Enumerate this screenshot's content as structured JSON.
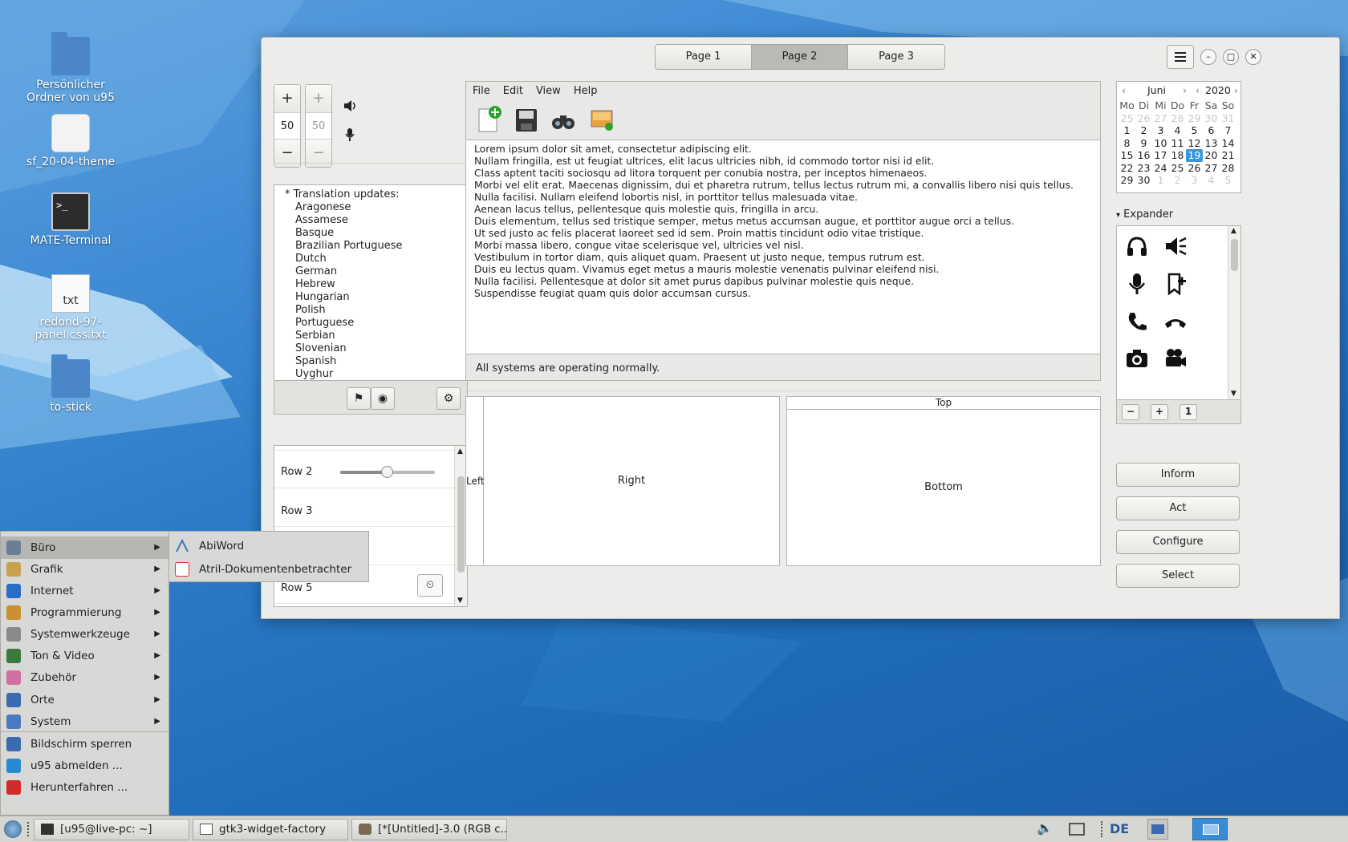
{
  "desktop": {
    "icons": [
      {
        "label": "Persönlicher Ordner von u95",
        "icon": "home-folder-icon"
      },
      {
        "label": "sf_20-04-theme",
        "icon": "drive-icon"
      },
      {
        "label": "MATE-Terminal",
        "icon": "terminal-icon"
      },
      {
        "label": "redond-97-panel.css.txt",
        "icon": "text-file-icon"
      },
      {
        "label": "to-stick",
        "icon": "folder-icon"
      }
    ],
    "terminal_prompt": ">_",
    "file_badge": "txt"
  },
  "window": {
    "tabs": [
      "Page 1",
      "Page 2",
      "Page 3"
    ],
    "active_tab": "Page 2",
    "spin1": {
      "plus": "+",
      "value": "50",
      "minus": "−"
    },
    "spin2": {
      "plus": "+",
      "value": "50",
      "minus": "−"
    },
    "list": {
      "header": "* Translation updates:",
      "items": [
        "Aragonese",
        "Assamese",
        "Basque",
        "Brazilian Portuguese",
        "Dutch",
        "German",
        "Hebrew",
        "Hungarian",
        "Polish",
        "Portuguese",
        "Serbian",
        "Slovenian",
        "Spanish",
        "Uyghur"
      ]
    },
    "rows": {
      "row2": "Row 2",
      "row3": "Row 3",
      "row5": "Row 5",
      "slider_value": 0.49
    },
    "menu": [
      "File",
      "Edit",
      "View",
      "Help"
    ],
    "text_lines": [
      "Lorem ipsum dolor sit amet, consectetur adipiscing elit.",
      "Nullam fringilla, est ut feugiat ultrices, elit lacus ultricies nibh, id commodo tortor nisi id elit.",
      "Class aptent taciti sociosqu ad litora torquent per conubia nostra, per inceptos himenaeos.",
      "Morbi vel elit erat. Maecenas dignissim, dui et pharetra rutrum, tellus lectus rutrum mi, a convallis libero nisi quis tellus.",
      "Nulla facilisi. Nullam eleifend lobortis nisl, in porttitor tellus malesuada vitae.",
      "Aenean lacus tellus, pellentesque quis molestie quis, fringilla in arcu.",
      "Duis elementum, tellus sed tristique semper, metus metus accumsan augue, et porttitor augue orci a tellus.",
      "Ut sed justo ac felis placerat laoreet sed id sem. Proin mattis tincidunt odio vitae tristique.",
      "Morbi massa libero, congue vitae scelerisque vel, ultricies vel nisl.",
      "Vestibulum in tortor diam, quis aliquet quam. Praesent ut justo neque, tempus rutrum est.",
      "Duis eu lectus quam. Vivamus eget metus a mauris molestie venenatis pulvinar eleifend nisi.",
      "Nulla facilisi. Pellentesque at dolor sit amet purus dapibus pulvinar molestie quis neque.",
      "Suspendisse feugiat quam quis dolor accumsan cursus."
    ],
    "status": "All systems are operating normally.",
    "panes": {
      "left": "Left",
      "right": "Right",
      "top": "Top",
      "bottom": "Bottom"
    },
    "calendar": {
      "month": "Juni",
      "year": "2020",
      "prev": "‹",
      "next": "›",
      "weekdays": [
        "Mo",
        "Di",
        "Mi",
        "Do",
        "Fr",
        "Sa",
        "So"
      ],
      "weeks": [
        [
          [
            "25",
            1
          ],
          [
            "26",
            1
          ],
          [
            "27",
            1
          ],
          [
            "28",
            1
          ],
          [
            "29",
            1
          ],
          [
            "30",
            1
          ],
          [
            "31",
            1
          ]
        ],
        [
          [
            "1",
            0
          ],
          [
            "2",
            0
          ],
          [
            "3",
            0
          ],
          [
            "4",
            0
          ],
          [
            "5",
            0
          ],
          [
            "6",
            0
          ],
          [
            "7",
            0
          ]
        ],
        [
          [
            "8",
            0
          ],
          [
            "9",
            0
          ],
          [
            "10",
            0
          ],
          [
            "11",
            0
          ],
          [
            "12",
            0
          ],
          [
            "13",
            0
          ],
          [
            "14",
            0
          ]
        ],
        [
          [
            "15",
            0
          ],
          [
            "16",
            0
          ],
          [
            "17",
            0
          ],
          [
            "18",
            0
          ],
          [
            "19",
            2
          ],
          [
            "20",
            0
          ],
          [
            "21",
            0
          ]
        ],
        [
          [
            "22",
            0
          ],
          [
            "23",
            0
          ],
          [
            "24",
            0
          ],
          [
            "25",
            0
          ],
          [
            "26",
            0
          ],
          [
            "27",
            0
          ],
          [
            "28",
            0
          ]
        ],
        [
          [
            "29",
            0
          ],
          [
            "30",
            0
          ],
          [
            "1",
            1
          ],
          [
            "2",
            1
          ],
          [
            "3",
            1
          ],
          [
            "4",
            1
          ],
          [
            "5",
            1
          ]
        ]
      ]
    },
    "expander": {
      "arrow": "▾",
      "label": "Expander"
    },
    "icon_bar": [
      "−",
      "+",
      "1"
    ],
    "right_buttons": [
      "Inform",
      "Act",
      "Configure",
      "Select"
    ]
  },
  "start_menu": {
    "items": [
      {
        "label": "Büro",
        "submenu": true,
        "color": "#6a7e96"
      },
      {
        "label": "Grafik",
        "submenu": true,
        "color": "#c8a050"
      },
      {
        "label": "Internet",
        "submenu": true,
        "color": "#2b6cc4"
      },
      {
        "label": "Programmierung",
        "submenu": true,
        "color": "#c89030"
      },
      {
        "label": "Systemwerkzeuge",
        "submenu": true,
        "color": "#8a8a8a"
      },
      {
        "label": "Ton & Video",
        "submenu": true,
        "color": "#3a7a3a"
      },
      {
        "label": "Zubehör",
        "submenu": true,
        "color": "#d070a0"
      },
      {
        "label": "Orte",
        "submenu": true,
        "color": "#3a6ab0"
      },
      {
        "label": "System",
        "submenu": true,
        "color": "#4a7ac0"
      },
      {
        "label": "Bildschirm sperren",
        "submenu": false,
        "color": "#3a6ab0"
      },
      {
        "label": "u95 abmelden ...",
        "submenu": false,
        "color": "#2a8ad0"
      },
      {
        "label": "Herunterfahren ...",
        "submenu": false,
        "color": "#d02a2a"
      }
    ],
    "submenu_items": [
      "AbiWord",
      "Atril-Dokumentenbetrachter"
    ]
  },
  "taskbar": {
    "buttons": [
      "[u95@live-pc: ~]",
      "gtk3-widget-factory",
      "[*[Untitled]-3.0 (RGB c..."
    ],
    "keyboard_layout": "DE"
  }
}
